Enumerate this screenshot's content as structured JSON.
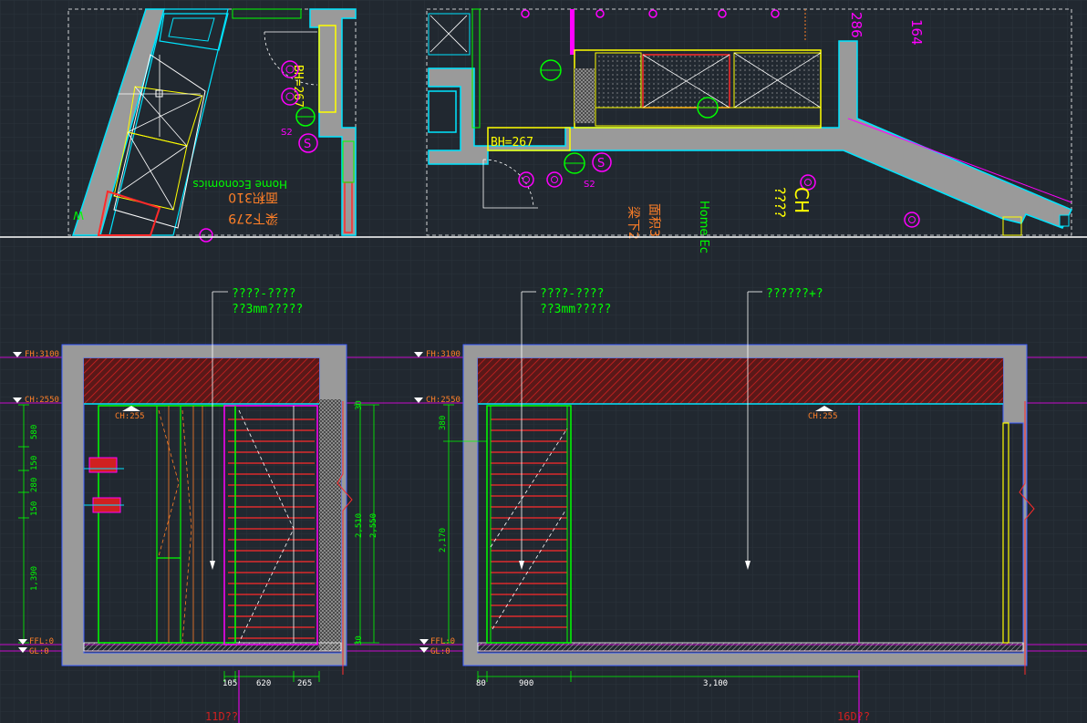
{
  "colors": {
    "background": "#212830",
    "grid": "#2b333c",
    "wall": "#9a9a9a",
    "cyan": "#00e5ff",
    "green": "#00ff00",
    "red": "#ff2a2a",
    "magenta": "#ff00ff",
    "orange": "#ff7f27",
    "yellow": "#ffff00",
    "white": "#ffffff",
    "blue": "#3a5cff"
  },
  "plan": {
    "left_labels": {
      "zone_en": "Home Economics",
      "area_1": "面积310",
      "area_2": "梁下279",
      "mark_w": "W"
    },
    "bh_left": "BH=267",
    "bh_mid": "BH=267",
    "left_s": "S",
    "left_s2": "S2",
    "right_labels": {
      "ch": "CH",
      "q": "????",
      "zone_en": "Home Ec",
      "area_1": "面积3",
      "area_2": "梁下2"
    },
    "right_s": "S",
    "right_s2": "S2",
    "dim_164": "164",
    "dim_286": "286"
  },
  "elev_left": {
    "note_1": "????-????",
    "note_2": "??3mm?????",
    "fh": "FH:3100",
    "ch": "CH:2550",
    "ffl": "FFL:0",
    "gl": "GL:0",
    "ch_mark": "CH:255",
    "dims_v": [
      "580",
      "150",
      "280",
      "150",
      "1,390"
    ],
    "dim_2510": "2,510",
    "dim_2550": "2,550",
    "dim_30_top": "30",
    "dim_30_bot": "30",
    "dims_b": [
      "105",
      "620",
      "265"
    ],
    "section": "11D??"
  },
  "elev_right": {
    "note_1": "????-????",
    "note_2": "??3mm?????",
    "note_3": "??????+?",
    "fh": "FH:3100",
    "ch": "CH:2550",
    "ffl": "FFL:0",
    "gl": "GL:0",
    "ch_mark": "CH:255",
    "dim_380": "380",
    "dim_2170": "2,170",
    "dims_b": [
      "80",
      "900",
      "3,100"
    ],
    "section": "16D??"
  }
}
